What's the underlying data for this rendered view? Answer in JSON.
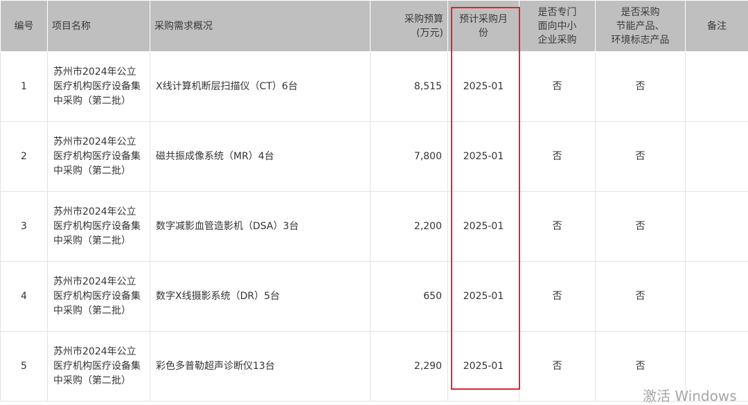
{
  "table": {
    "headers": {
      "no": "编号",
      "project": "项目名称",
      "demand": "采购需求概况",
      "budget": "采购预算\n(万元)",
      "month": "预计采购月\n份",
      "sme": "是否专门\n面向中小\n企业采购",
      "eco": "是否采购\n节能产品、\n环境标志产品",
      "remark": "备注"
    },
    "rows": [
      {
        "no": "1",
        "project": "苏州市2024年公立医疗机构医疗设备集中采购（第二批）",
        "demand": "X线计算机断层扫描仪（CT）6台",
        "budget": "8,515",
        "month": "2025-01",
        "sme": "否",
        "eco": "否",
        "remark": ""
      },
      {
        "no": "2",
        "project": "苏州市2024年公立医疗机构医疗设备集中采购（第二批）",
        "demand": "磁共振成像系统（MR）4台",
        "budget": "7,800",
        "month": "2025-01",
        "sme": "否",
        "eco": "否",
        "remark": ""
      },
      {
        "no": "3",
        "project": "苏州市2024年公立医疗机构医疗设备集中采购（第二批）",
        "demand": "数字减影血管造影机（DSA）3台",
        "budget": "2,200",
        "month": "2025-01",
        "sme": "否",
        "eco": "否",
        "remark": ""
      },
      {
        "no": "4",
        "project": "苏州市2024年公立医疗机构医疗设备集中采购（第二批）",
        "demand": "数字X线摄影系统（DR）5台",
        "budget": "650",
        "month": "2025-01",
        "sme": "否",
        "eco": "否",
        "remark": ""
      },
      {
        "no": "5",
        "project": "苏州市2024年公立医疗机构医疗设备集中采购（第二批）",
        "demand": "彩色多普勒超声诊断仪13台",
        "budget": "2,290",
        "month": "2025-01",
        "sme": "否",
        "eco": "否",
        "remark": ""
      }
    ]
  },
  "watermark": "激活 Windows",
  "colors": {
    "header_bg": "#bfbfbf",
    "highlight_border": "#e8202a"
  }
}
